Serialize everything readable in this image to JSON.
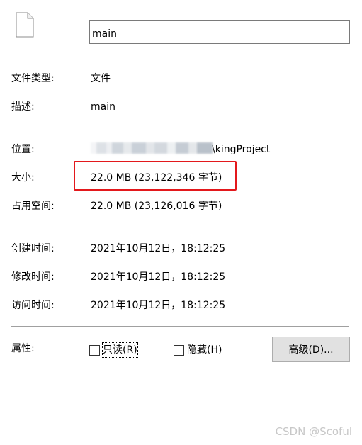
{
  "header": {
    "file_icon": "file-icon",
    "name_value": "main"
  },
  "general": {
    "type_label": "文件类型:",
    "type_value": "文件",
    "desc_label": "描述:",
    "desc_value": "main"
  },
  "location": {
    "location_label": "位置:",
    "location_value_suffix": "\\kingProject",
    "size_label": "大小:",
    "size_value": "22.0 MB (23,122,346 字节)",
    "disk_label": "占用空间:",
    "disk_value": "22.0 MB (23,126,016 字节)"
  },
  "times": {
    "created_label": "创建时间:",
    "created_value": "2021年10月12日，18:12:25",
    "modified_label": "修改时间:",
    "modified_value": "2021年10月12日，18:12:25",
    "accessed_label": "访问时间:",
    "accessed_value": "2021年10月12日，18:12:25"
  },
  "attributes": {
    "label": "属性:",
    "readonly_label": "只读(R)",
    "hidden_label": "隐藏(H)",
    "advanced_label": "高级(D)..."
  },
  "watermark": "CSDN @Scoful",
  "colors": {
    "highlight": "#e3181c",
    "separator": "#a0a0a0"
  }
}
